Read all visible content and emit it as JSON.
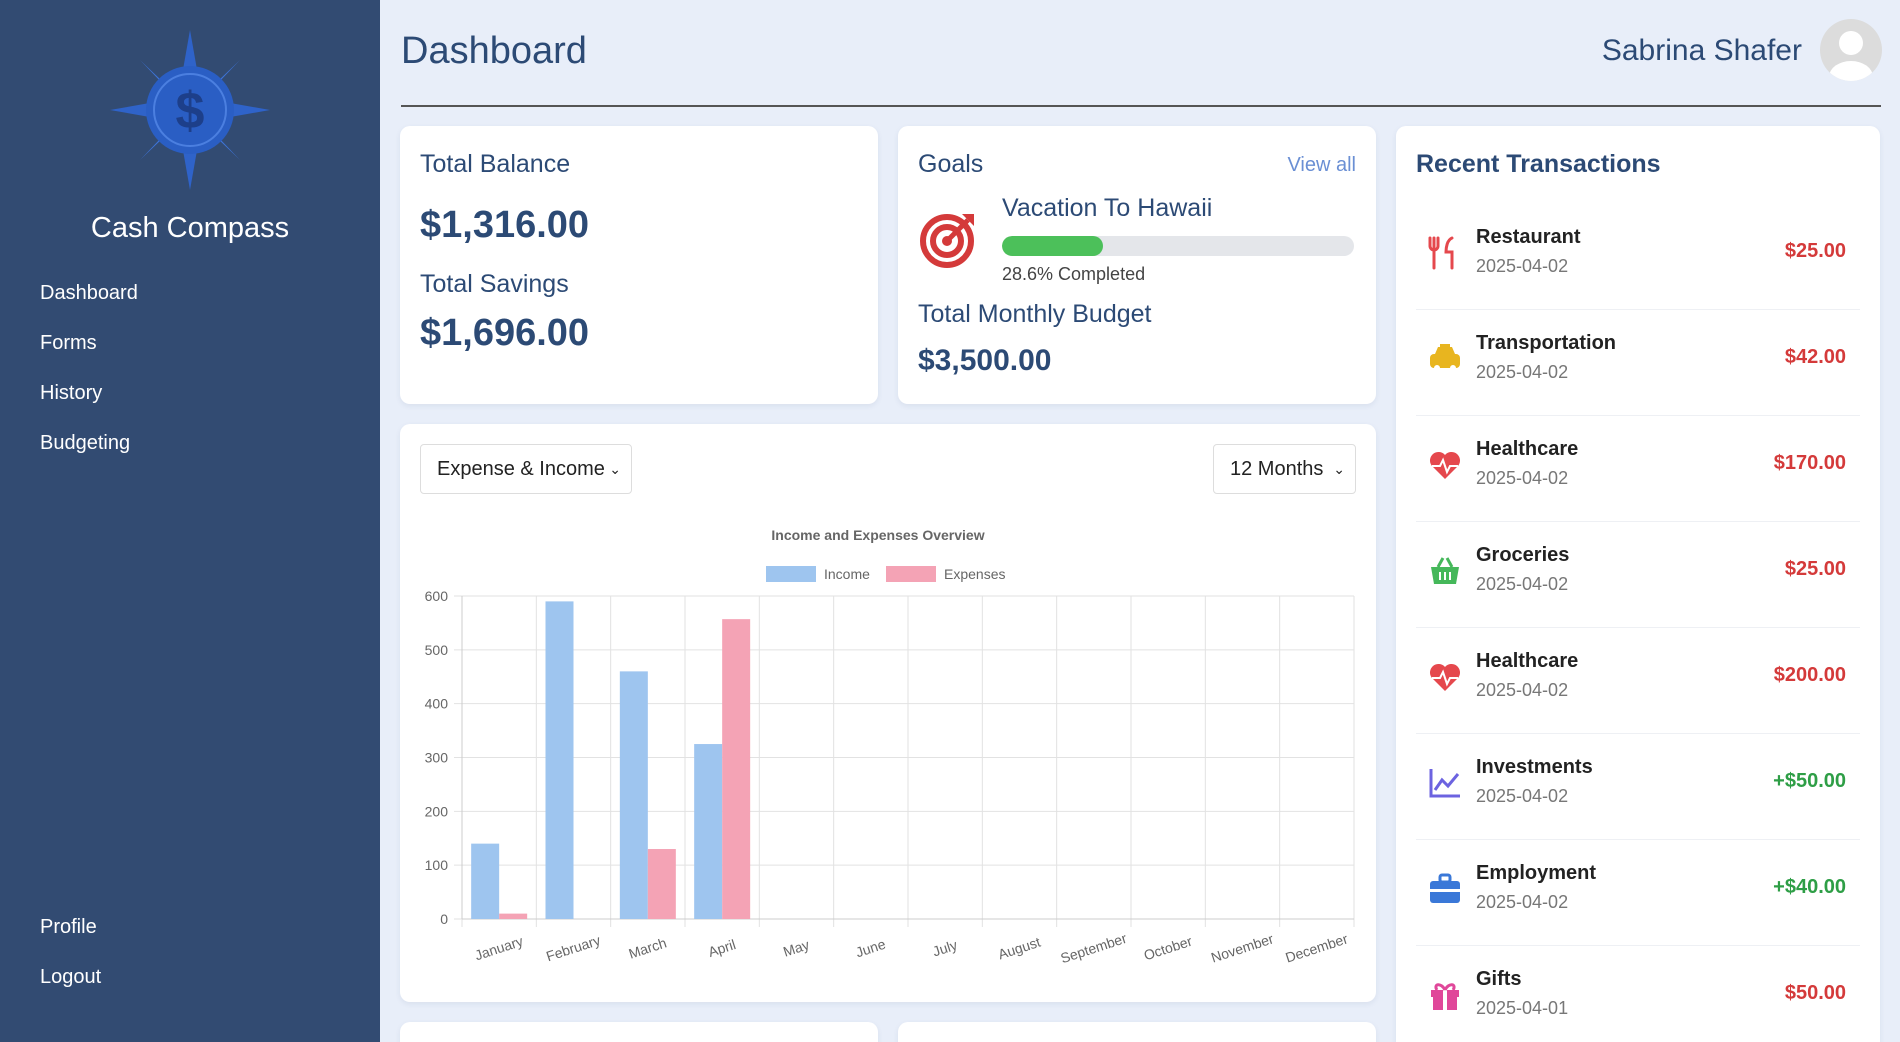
{
  "sidebar": {
    "brand": "Cash Compass",
    "nav": [
      "Dashboard",
      "Forms",
      "History",
      "Budgeting"
    ],
    "bottom_nav": [
      "Profile",
      "Logout"
    ],
    "logo_icon": "compass-dollar-logo-icon"
  },
  "header": {
    "title": "Dashboard",
    "user_name": "Sabrina Shafer",
    "avatar_icon": "user-avatar-icon"
  },
  "balance": {
    "total_balance_label": "Total Balance",
    "total_balance": "$1,316.00",
    "total_savings_label": "Total Savings",
    "total_savings": "$1,696.00"
  },
  "goals": {
    "title": "Goals",
    "view_all": "View all",
    "goal_name": "Vacation To Hawaii",
    "progress_percent": 28.6,
    "progress_text": "28.6% Completed",
    "goal_icon": "target-icon",
    "budget_label": "Total Monthly Budget",
    "budget_value": "$3,500.00"
  },
  "chart_panel": {
    "type_select": "Expense & Income",
    "range_select": "12 Months"
  },
  "chart_data": {
    "type": "bar",
    "title": "Income and Expenses Overview",
    "categories": [
      "January",
      "February",
      "March",
      "April",
      "May",
      "June",
      "July",
      "August",
      "September",
      "October",
      "November",
      "December"
    ],
    "series": [
      {
        "name": "Income",
        "values": [
          140,
          590,
          460,
          325,
          0,
          0,
          0,
          0,
          0,
          0,
          0,
          0
        ],
        "color": "#9ec5ef"
      },
      {
        "name": "Expenses",
        "values": [
          10,
          0,
          130,
          557,
          0,
          0,
          0,
          0,
          0,
          0,
          0,
          0
        ],
        "color": "#f4a3b5"
      }
    ],
    "y_ticks": [
      "0",
      "100",
      "200",
      "300",
      "400",
      "500",
      "600"
    ],
    "ylim": [
      0,
      600
    ],
    "grid": true,
    "legend": "top"
  },
  "transactions": {
    "title": "Recent Transactions",
    "items": [
      {
        "name": "Restaurant",
        "date": "2025-04-02",
        "amount": "$25.00",
        "icon": "utensils-icon",
        "color": "#e5484d",
        "amount_color": "#d43a3a"
      },
      {
        "name": "Transportation",
        "date": "2025-04-02",
        "amount": "$42.00",
        "icon": "taxi-icon",
        "color": "#e8b51f",
        "amount_color": "#d43a3a"
      },
      {
        "name": "Healthcare",
        "date": "2025-04-02",
        "amount": "$170.00",
        "icon": "heart-pulse-icon",
        "color": "#e5484d",
        "amount_color": "#d43a3a"
      },
      {
        "name": "Groceries",
        "date": "2025-04-02",
        "amount": "$25.00",
        "icon": "basket-icon",
        "color": "#45b85a",
        "amount_color": "#d43a3a"
      },
      {
        "name": "Healthcare",
        "date": "2025-04-02",
        "amount": "$200.00",
        "icon": "heart-pulse-icon",
        "color": "#e5484d",
        "amount_color": "#d43a3a"
      },
      {
        "name": "Investments",
        "date": "2025-04-02",
        "amount": "+$50.00",
        "icon": "chart-line-icon",
        "color": "#6c63e0",
        "amount_color": "#2e9e46"
      },
      {
        "name": "Employment",
        "date": "2025-04-02",
        "amount": "+$40.00",
        "icon": "briefcase-icon",
        "color": "#3a78d8",
        "amount_color": "#2e9e46"
      },
      {
        "name": "Gifts",
        "date": "2025-04-01",
        "amount": "$50.00",
        "icon": "gift-icon",
        "color": "#e0479a",
        "amount_color": "#d43a3a"
      }
    ]
  }
}
